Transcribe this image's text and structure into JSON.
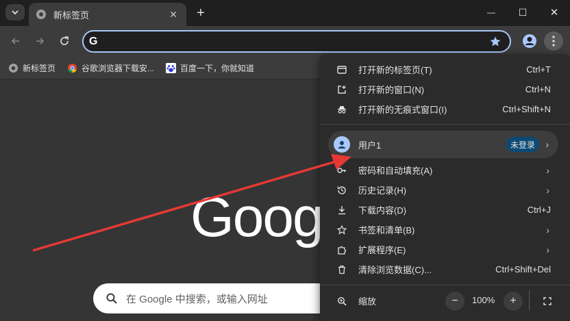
{
  "tab": {
    "title": "新标签页",
    "close": "✕"
  },
  "window": {
    "minimize": "—",
    "maximize": "☐",
    "close": "✕"
  },
  "omnibox": {
    "value": "",
    "icon": "G"
  },
  "bookmarks": [
    {
      "label": "新标签页",
      "icon": "chrome-logo-icon"
    },
    {
      "label": "谷歌浏览器下载安...",
      "icon": "chrome-color-icon"
    },
    {
      "label": "百度一下，你就知道",
      "icon": "baidu-icon"
    }
  ],
  "ntp": {
    "logo": "Goog",
    "search_placeholder": "在 Google 中搜索，或输入网址"
  },
  "menu": {
    "items_top": [
      {
        "label": "打开新的标签页(T)",
        "shortcut": "Ctrl+T"
      },
      {
        "label": "打开新的窗口(N)",
        "shortcut": "Ctrl+N"
      },
      {
        "label": "打开新的无痕式窗口(I)",
        "shortcut": "Ctrl+Shift+N"
      }
    ],
    "profile": {
      "name": "用户1",
      "badge": "未登录"
    },
    "items_mid": [
      {
        "label": "密码和自动填充(A)",
        "shortcut": ""
      },
      {
        "label": "历史记录(H)",
        "shortcut": ""
      },
      {
        "label": "下载内容(D)",
        "shortcut": "Ctrl+J"
      },
      {
        "label": "书签和清单(B)",
        "shortcut": ""
      },
      {
        "label": "扩展程序(E)",
        "shortcut": ""
      },
      {
        "label": "清除浏览数据(C)...",
        "shortcut": "Ctrl+Shift+Del"
      }
    ],
    "zoom": {
      "label": "缩放",
      "value": "100%",
      "minus": "−",
      "plus": "+"
    }
  },
  "colors": {
    "accent": "#a8c7fa",
    "annotation_arrow": "#e53935",
    "menu_bg": "#2b2b2b"
  }
}
